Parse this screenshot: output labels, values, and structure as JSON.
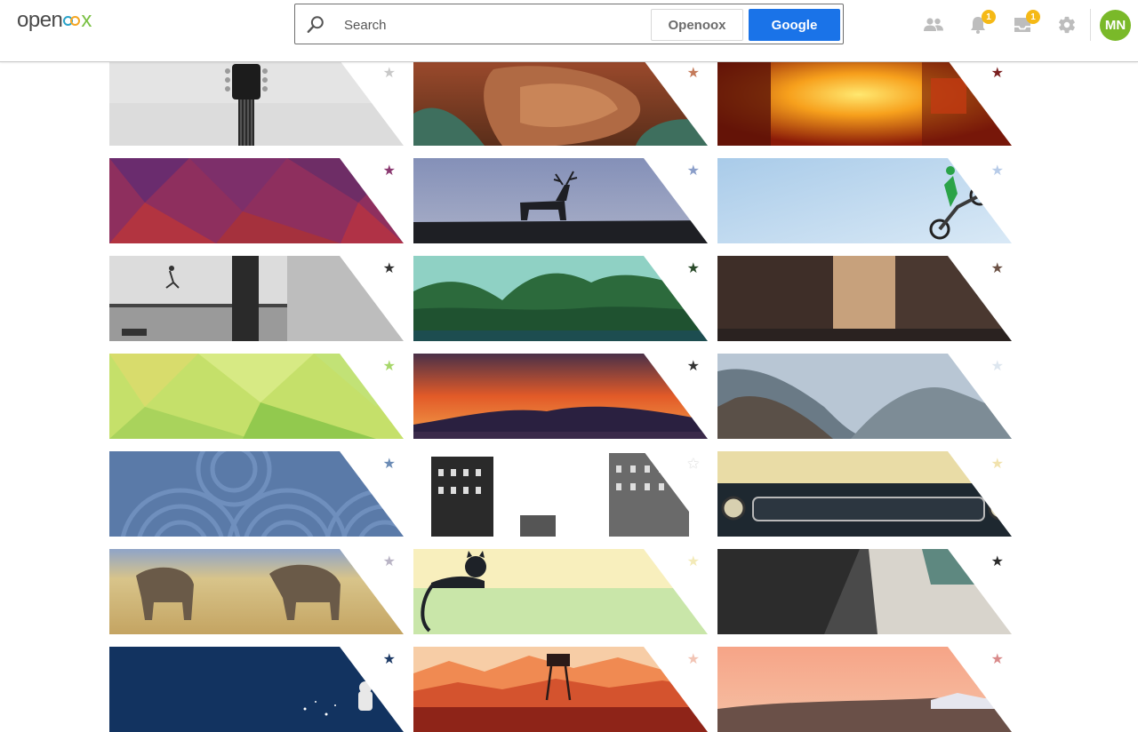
{
  "header": {
    "logo_prefix": "open",
    "logo_suffix": "x",
    "search": {
      "placeholder": "Search",
      "engine_alt_label": "Openoox",
      "engine_primary_label": "Google"
    },
    "notifications_count": "1",
    "inbox_count": "1",
    "avatar_initials": "MN"
  },
  "colors": {
    "accent_blue": "#1a73e8",
    "badge_yellow": "#f5b916",
    "avatar_green": "#7ab929"
  },
  "icons": {
    "search": "search-icon",
    "people": "people-icon",
    "notifications": "bell-icon",
    "inbox": "inbox-icon",
    "settings": "gear-icon",
    "star": "star-icon"
  },
  "tiles": [
    {
      "subject": "guitar",
      "star_color": "#c8c8c8"
    },
    {
      "subject": "canyon",
      "star_color": "#c47a5a"
    },
    {
      "subject": "city-sunset",
      "star_color": "#7a1f1f"
    },
    {
      "subject": "purple-poly",
      "star_color": "#8a3870"
    },
    {
      "subject": "deer",
      "star_color": "#8a9ec9"
    },
    {
      "subject": "motocross",
      "star_color": "#b7cbe8"
    },
    {
      "subject": "runner",
      "star_color": "#333333"
    },
    {
      "subject": "forest-lake",
      "star_color": "#2a4a2a"
    },
    {
      "subject": "old-street",
      "star_color": "#6b5145"
    },
    {
      "subject": "green-poly",
      "star_color": "#a7d76a"
    },
    {
      "subject": "sunset",
      "star_color": "#333333"
    },
    {
      "subject": "mountains",
      "star_color": "#dde6ef"
    },
    {
      "subject": "waves",
      "star_color": "#6b8bb5"
    },
    {
      "subject": "buildings",
      "star_color": "#ffffff"
    },
    {
      "subject": "car",
      "star_color": "#f1e2ad"
    },
    {
      "subject": "elephants",
      "star_color": "#b9b4c5"
    },
    {
      "subject": "cat",
      "star_color": "#f3eab8"
    },
    {
      "subject": "aerial-city",
      "star_color": "#2a2a2a"
    },
    {
      "subject": "astronaut",
      "star_color": "#1d3a66"
    },
    {
      "subject": "fire-tower",
      "star_color": "#f2c4b4"
    },
    {
      "subject": "pink-sky",
      "star_color": "#d98a8a"
    }
  ]
}
